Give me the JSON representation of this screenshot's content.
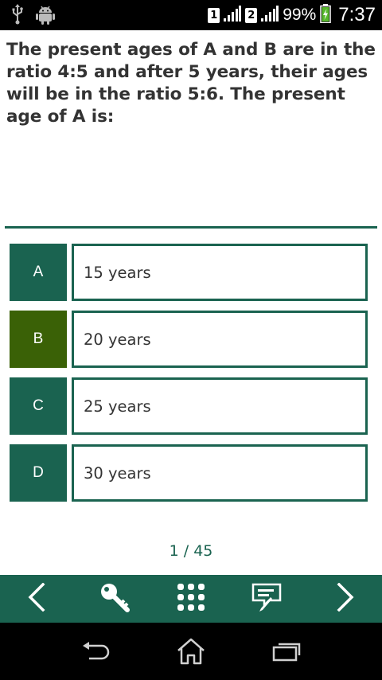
{
  "status_bar": {
    "sim1": "1",
    "sim2": "2",
    "battery_percent": "99%",
    "time": "7:37",
    "icons": [
      "usb-icon",
      "android-icon",
      "signal-icon",
      "battery-charging-icon"
    ]
  },
  "question": {
    "text": "The present ages of A and B are in the ratio 4:5 and after 5 years, their ages will be in the ratio 5:6. The present age of A is:"
  },
  "options": [
    {
      "letter": "A",
      "text": "15 years",
      "selected": false
    },
    {
      "letter": "B",
      "text": "20 years",
      "selected": true
    },
    {
      "letter": "C",
      "text": "25 years",
      "selected": false
    },
    {
      "letter": "D",
      "text": "30 years",
      "selected": false
    }
  ],
  "pager": {
    "text": "1 / 45"
  },
  "toolbar": {
    "buttons": [
      "previous-icon",
      "key-icon",
      "grid-icon",
      "notes-icon",
      "next-icon"
    ]
  },
  "navbar": {
    "buttons": [
      "back-icon",
      "home-icon",
      "recent-apps-icon"
    ]
  },
  "colors": {
    "primary": "#1a6350",
    "selected": "#3a6106",
    "text": "#333333"
  }
}
